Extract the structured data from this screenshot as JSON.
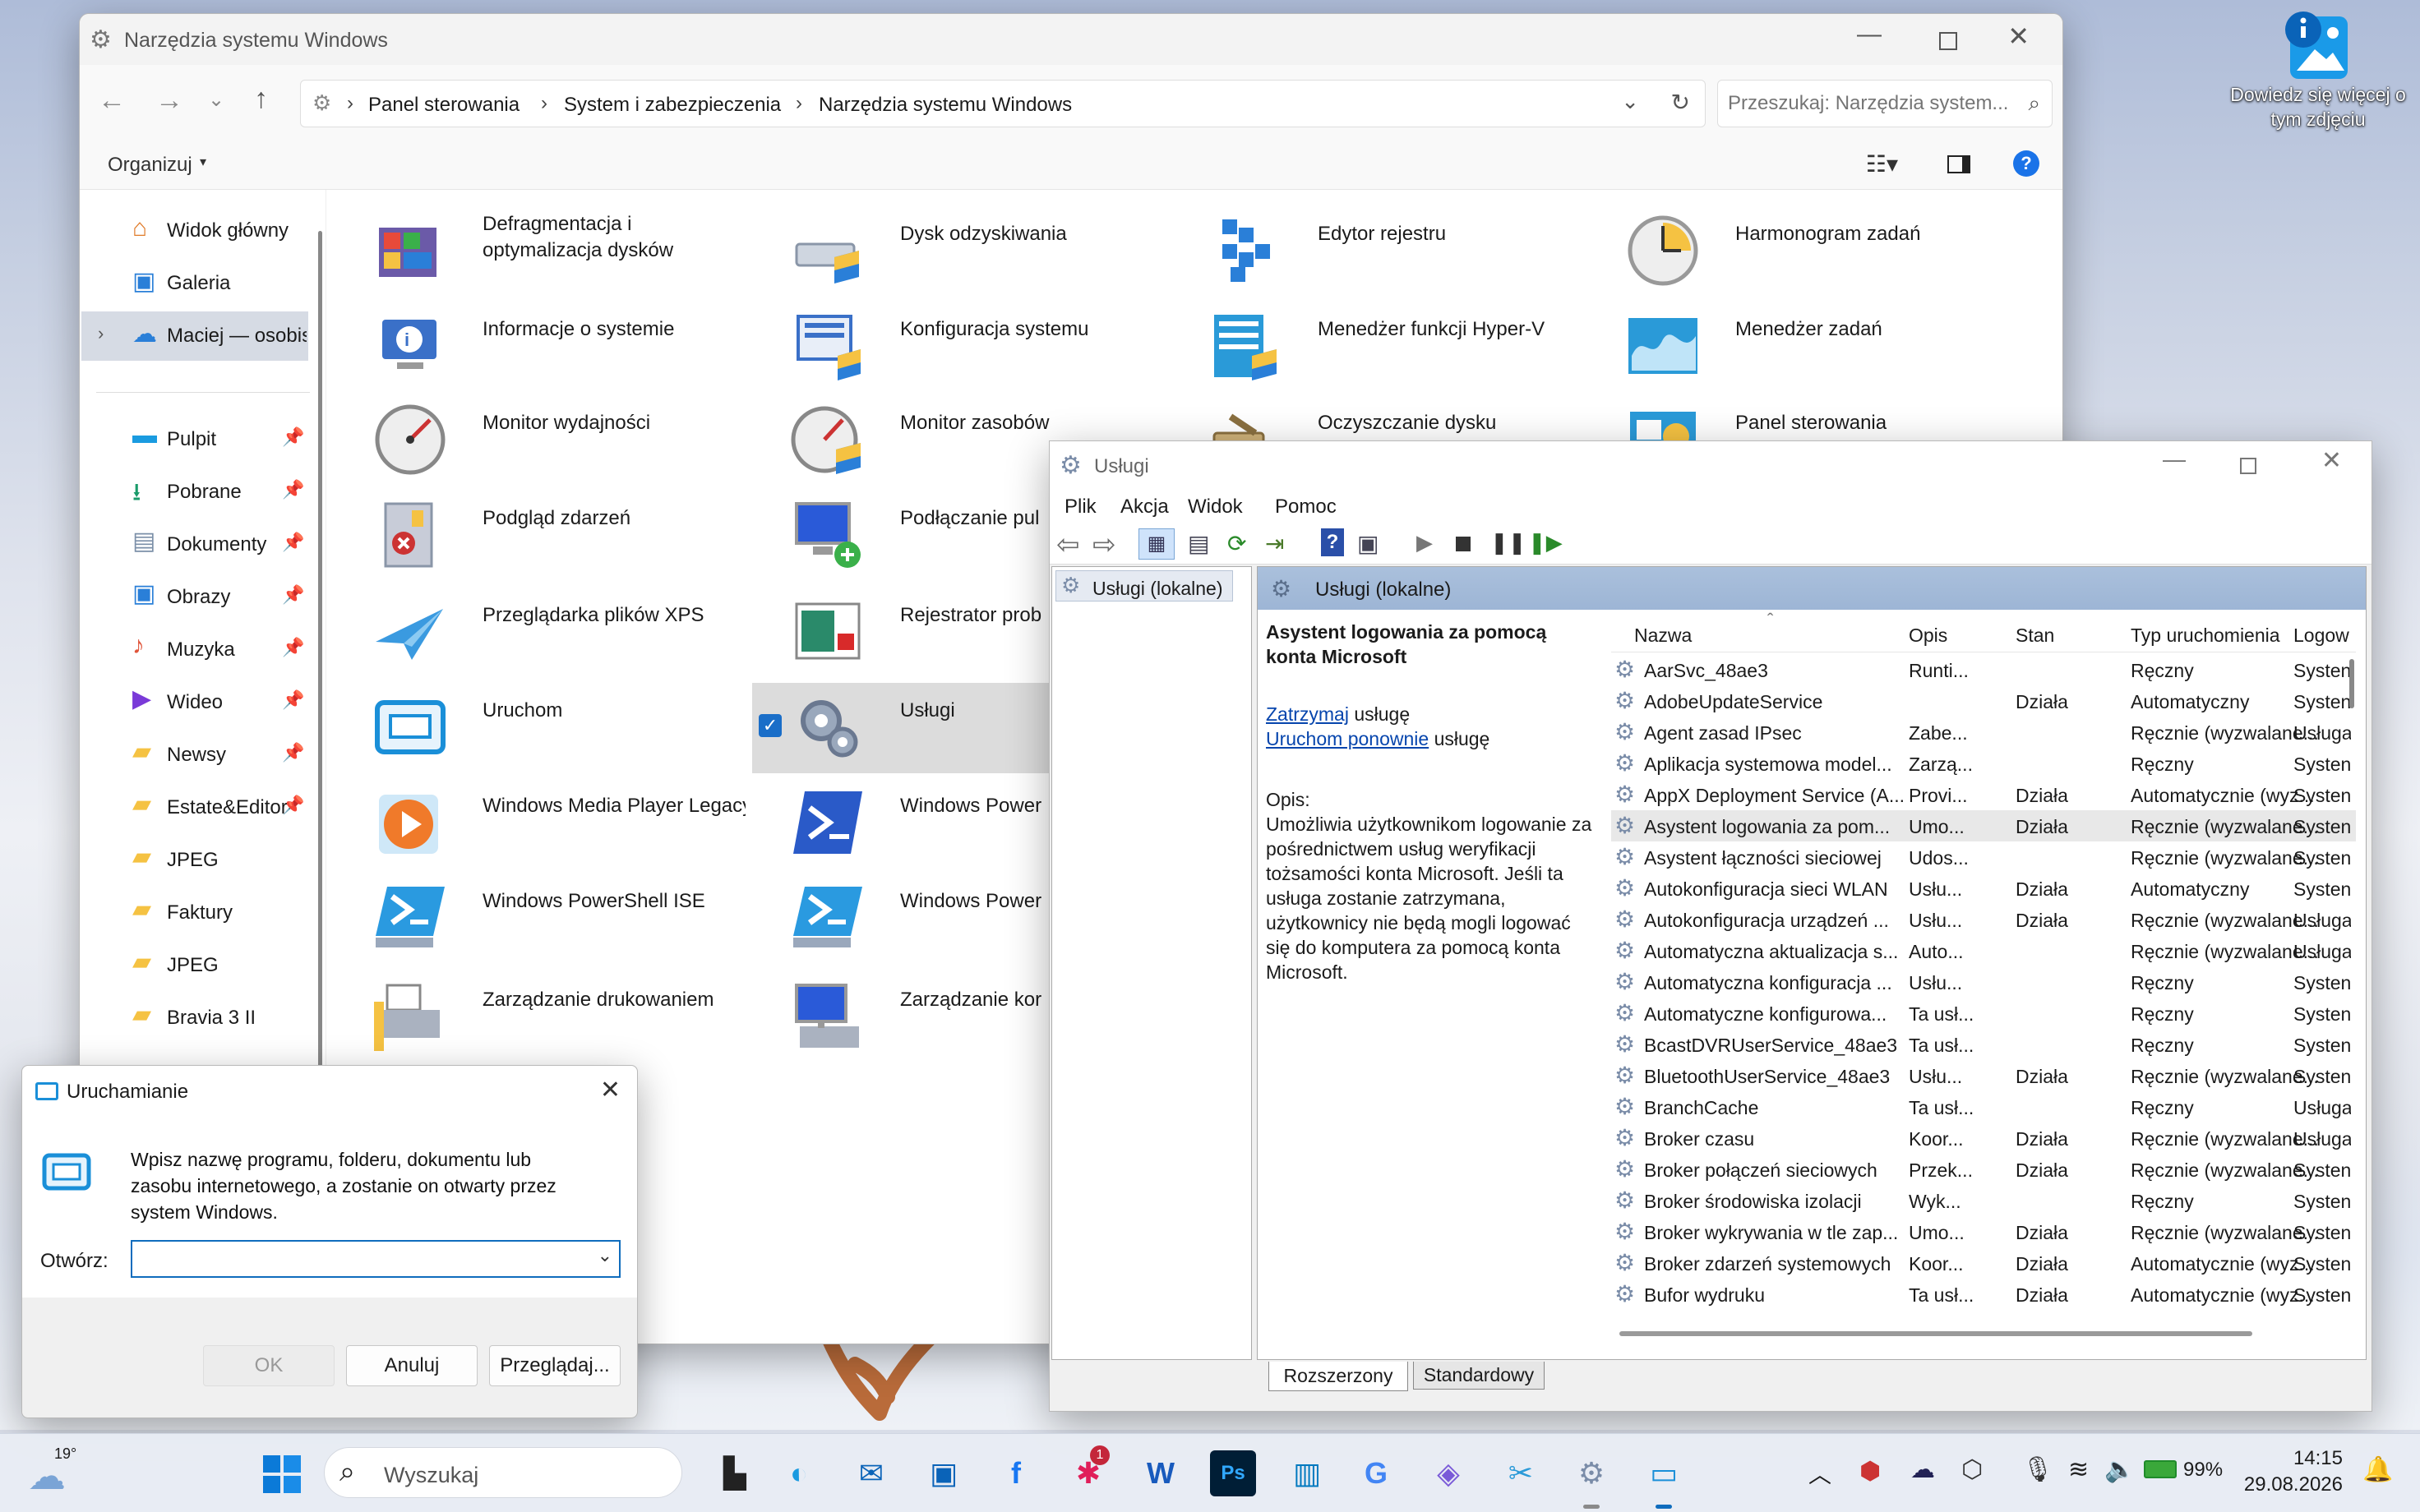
{
  "desktop": {
    "photo_label_line1": "Dowiedz się więcej o",
    "photo_label_line2": "tym zdjęciu"
  },
  "explorer": {
    "title": "Narzędzia systemu Windows",
    "breadcrumb": [
      "Panel sterowania",
      "System i zabezpieczenia",
      "Narzędzia systemu Windows"
    ],
    "search_placeholder": "Przeszukaj: Narzędzia system...",
    "organize": "Organizuj",
    "nav_top": [
      "Widok główny",
      "Galeria",
      "Maciej — osobis"
    ],
    "nav_pinned": [
      "Pulpit",
      "Pobrane",
      "Dokumenty",
      "Obrazy",
      "Muzyka",
      "Wideo",
      "Newsy",
      "Estate&Editor",
      "JPEG",
      "Faktury",
      "JPEG",
      "Bravia 3 II"
    ],
    "tools": [
      {
        "line1": "Defragmentacja i",
        "line2": "optymalizacja dysków",
        "icon": "defrag-icon"
      },
      {
        "line1": "Dysk odzyskiwania",
        "line2": "",
        "icon": "recovery-drive-icon"
      },
      {
        "line1": "Edytor rejestru",
        "line2": "",
        "icon": "registry-icon"
      },
      {
        "line1": "Harmonogram zadań",
        "line2": "",
        "icon": "clock-icon"
      },
      {
        "line1": "Informacje o systemie",
        "line2": "",
        "icon": "info-icon"
      },
      {
        "line1": "Konfiguracja systemu",
        "line2": "",
        "icon": "msconfig-icon"
      },
      {
        "line1": "Menedżer funkcji Hyper-V",
        "line2": "",
        "icon": "hyperv-icon"
      },
      {
        "line1": "Menedżer zadań",
        "line2": "",
        "icon": "taskmgr-icon"
      },
      {
        "line1": "Monitor wydajności",
        "line2": "",
        "icon": "perfmon-icon"
      },
      {
        "line1": "Monitor zasobów",
        "line2": "",
        "icon": "resmon-icon"
      },
      {
        "line1": "Oczyszczanie dysku",
        "line2": "",
        "icon": "cleanup-icon"
      },
      {
        "line1": "Panel sterowania",
        "line2": "",
        "icon": "control-panel-icon"
      },
      {
        "line1": "Podgląd zdarzeń",
        "line2": "",
        "icon": "eventviewer-icon"
      },
      {
        "line1": "Podłączanie pul",
        "line2": "",
        "icon": "rdp-icon"
      },
      {
        "line1": "",
        "line2": "",
        "icon": "none"
      },
      {
        "line1": "",
        "line2": "",
        "icon": "none"
      },
      {
        "line1": "Przeglądarka plików XPS",
        "line2": "",
        "icon": "xps-icon"
      },
      {
        "line1": "Rejestrator prob",
        "line2": "",
        "icon": "steps-recorder-icon"
      },
      {
        "line1": "",
        "line2": "",
        "icon": "none"
      },
      {
        "line1": "",
        "line2": "",
        "icon": "none"
      },
      {
        "line1": "Uruchom",
        "line2": "",
        "icon": "run-icon"
      },
      {
        "line1": "Usługi",
        "line2": "",
        "icon": "services-icon"
      },
      {
        "line1": "",
        "line2": "",
        "icon": "none"
      },
      {
        "line1": "",
        "line2": "",
        "icon": "none"
      },
      {
        "line1": "Windows Media Player Legacy",
        "line2": "",
        "icon": "wmp-icon"
      },
      {
        "line1": "Windows Power",
        "line2": "",
        "icon": "powershell-icon"
      },
      {
        "line1": "",
        "line2": "",
        "icon": "none"
      },
      {
        "line1": "",
        "line2": "",
        "icon": "none"
      },
      {
        "line1": "Windows PowerShell ISE",
        "line2": "",
        "icon": "powershell-ise-icon"
      },
      {
        "line1": "Windows Power",
        "line2": "",
        "icon": "powershell-ise-icon"
      },
      {
        "line1": "",
        "line2": "",
        "icon": "none"
      },
      {
        "line1": "",
        "line2": "",
        "icon": "none"
      },
      {
        "line1": "Zarządzanie drukowaniem",
        "line2": "",
        "icon": "printer-icon"
      },
      {
        "line1": "Zarządzanie kor",
        "line2": "",
        "icon": "computer-mgmt-icon"
      }
    ]
  },
  "services": {
    "title": "Usługi",
    "menu": [
      "Plik",
      "Akcja",
      "Widok",
      "Pomoc"
    ],
    "tree_item": "Usługi (lokalne)",
    "panel_header": "Usługi (lokalne)",
    "selected_title": "Asystent logowania za pomocą konta Microsoft",
    "stop_link": "Zatrzymaj",
    "restart_link": "Uruchom ponownie",
    "action_suffix": "usługę",
    "desc_label": "Opis:",
    "description": "Umożliwia użytkownikom logowanie za pośrednictwem usług weryfikacji tożsamości konta Microsoft. Jeśli ta usługa zostanie zatrzymana, użytkownicy nie będą mogli logować się do komputera za pomocą konta Microsoft.",
    "columns": [
      "Nazwa",
      "Opis",
      "Stan",
      "Typ uruchomienia",
      "Logow"
    ],
    "rows": [
      {
        "name": "AarSvc_48ae3",
        "desc": "Runti...",
        "state": "",
        "start": "Ręczny",
        "logon": "Systen"
      },
      {
        "name": "AdobeUpdateService",
        "desc": "",
        "state": "Działa",
        "start": "Automatyczny",
        "logon": "Systen"
      },
      {
        "name": "Agent zasad IPsec",
        "desc": "Zabe...",
        "state": "",
        "start": "Ręcznie (wyzwalane...",
        "logon": "Usługa"
      },
      {
        "name": "Aplikacja systemowa model...",
        "desc": "Zarzą...",
        "state": "",
        "start": "Ręczny",
        "logon": "Systen"
      },
      {
        "name": "AppX Deployment Service (A...",
        "desc": "Provi...",
        "state": "Działa",
        "start": "Automatycznie (wyz...",
        "logon": "Systen"
      },
      {
        "name": "Asystent logowania za pom...",
        "desc": "Umo...",
        "state": "Działa",
        "start": "Ręcznie (wyzwalane...",
        "logon": "Systen"
      },
      {
        "name": "Asystent łączności sieciowej",
        "desc": "Udos...",
        "state": "",
        "start": "Ręcznie (wyzwalane...",
        "logon": "Systen"
      },
      {
        "name": "Autokonfiguracja sieci WLAN",
        "desc": "Usłu...",
        "state": "Działa",
        "start": "Automatyczny",
        "logon": "Systen"
      },
      {
        "name": "Autokonfiguracja urządzeń ...",
        "desc": "Usłu...",
        "state": "Działa",
        "start": "Ręcznie (wyzwalane...",
        "logon": "Usługa"
      },
      {
        "name": "Automatyczna aktualizacja s...",
        "desc": "Auto...",
        "state": "",
        "start": "Ręcznie (wyzwalane...",
        "logon": "Usługa"
      },
      {
        "name": "Automatyczna konfiguracja ...",
        "desc": "Usłu...",
        "state": "",
        "start": "Ręczny",
        "logon": "Systen"
      },
      {
        "name": "Automatyczne konfigurowa...",
        "desc": "Ta usł...",
        "state": "",
        "start": "Ręczny",
        "logon": "Systen"
      },
      {
        "name": "BcastDVRUserService_48ae3",
        "desc": "Ta usł...",
        "state": "",
        "start": "Ręczny",
        "logon": "Systen"
      },
      {
        "name": "BluetoothUserService_48ae3",
        "desc": "Usłu...",
        "state": "Działa",
        "start": "Ręcznie (wyzwalane...",
        "logon": "Systen"
      },
      {
        "name": "BranchCache",
        "desc": "Ta usł...",
        "state": "",
        "start": "Ręczny",
        "logon": "Usługa"
      },
      {
        "name": "Broker czasu",
        "desc": "Koor...",
        "state": "Działa",
        "start": "Ręcznie (wyzwalane...",
        "logon": "Usługa"
      },
      {
        "name": "Broker połączeń sieciowych",
        "desc": "Przek...",
        "state": "Działa",
        "start": "Ręcznie (wyzwalane...",
        "logon": "Systen"
      },
      {
        "name": "Broker środowiska izolacji",
        "desc": "Wyk...",
        "state": "",
        "start": "Ręczny",
        "logon": "Systen"
      },
      {
        "name": "Broker wykrywania w tle zap...",
        "desc": "Umo...",
        "state": "Działa",
        "start": "Ręcznie (wyzwalane...",
        "logon": "Systen"
      },
      {
        "name": "Broker zdarzeń systemowych",
        "desc": "Koor...",
        "state": "Działa",
        "start": "Automatycznie (wyz...",
        "logon": "Systen"
      },
      {
        "name": "Bufor wydruku",
        "desc": "Ta usł...",
        "state": "Działa",
        "start": "Automatycznie (wyz...",
        "logon": "Systen"
      }
    ],
    "tabs": [
      "Rozszerzony",
      "Standardowy"
    ]
  },
  "run": {
    "title": "Uruchamianie",
    "line1": "Wpisz nazwę programu, folderu, dokumentu lub",
    "line2": "zasobu internetowego, a zostanie on otwarty przez",
    "line3": "system Windows.",
    "label": "Otwórz:",
    "value": "",
    "ok": "OK",
    "cancel": "Anuluj",
    "browse": "Przeglądaj..."
  },
  "taskbar": {
    "temp": "19°",
    "search": "Wyszukaj",
    "slack_badge": "1",
    "battery": "99%",
    "time": "14:15",
    "date": "29.08.2026"
  }
}
